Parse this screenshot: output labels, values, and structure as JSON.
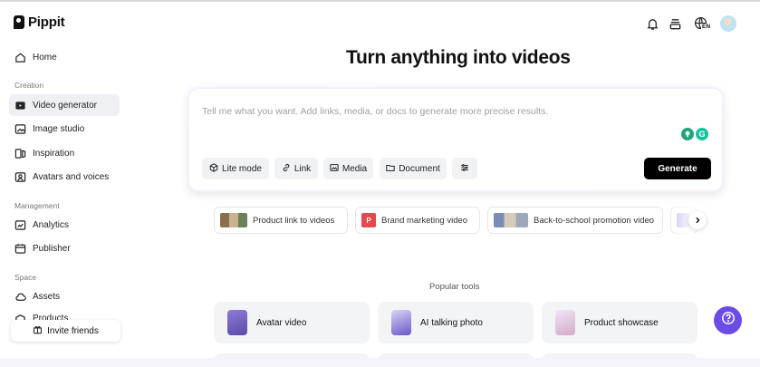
{
  "brand": {
    "name": "Pippit"
  },
  "sidebar": {
    "home": "Home",
    "sections": {
      "creation": "Creation",
      "management": "Management",
      "space": "Space"
    },
    "creation_items": [
      {
        "label": "Video generator",
        "icon": "video-generator-icon",
        "active": true
      },
      {
        "label": "Image studio",
        "icon": "image-studio-icon"
      },
      {
        "label": "Inspiration",
        "icon": "inspiration-icon"
      },
      {
        "label": "Avatars and voices",
        "icon": "avatar-icon"
      }
    ],
    "management_items": [
      {
        "label": "Analytics",
        "icon": "analytics-icon"
      },
      {
        "label": "Publisher",
        "icon": "calendar-icon"
      }
    ],
    "space_items": [
      {
        "label": "Assets",
        "icon": "cloud-icon"
      },
      {
        "label": "Products",
        "icon": "box-icon"
      }
    ],
    "invite_label": "Invite friends"
  },
  "header": {
    "icons": [
      "bell-icon",
      "inbox-icon",
      "language-icon"
    ],
    "language_badge": "EN"
  },
  "main": {
    "title": "Turn anything into videos",
    "prompt": {
      "placeholder": "Tell me what you want. Add links, media, or docs to generate more precise results.",
      "value": ""
    },
    "options": [
      {
        "label": "Lite mode",
        "icon": "cube-icon"
      },
      {
        "label": "Link",
        "icon": "link-icon"
      },
      {
        "label": "Media",
        "icon": "image-icon"
      },
      {
        "label": "Document",
        "icon": "folder-icon"
      }
    ],
    "settings_icon": "sliders-icon",
    "generate_label": "Generate",
    "suggestions": [
      {
        "label": "Product link to videos"
      },
      {
        "label": "Brand marketing video",
        "badge": "P"
      },
      {
        "label": "Back-to-school promotion video"
      }
    ],
    "popular_title": "Popular tools",
    "tools": [
      {
        "label": "Avatar video"
      },
      {
        "label": "AI talking photo"
      },
      {
        "label": "Product showcase"
      }
    ]
  },
  "colors": {
    "accent_purple": "#6b4ce6",
    "generate_bg": "#000000",
    "active_nav_bg": "#eef0f3",
    "brand_badge_red": "#e5484d",
    "grammarly_green": "#15c39a"
  }
}
